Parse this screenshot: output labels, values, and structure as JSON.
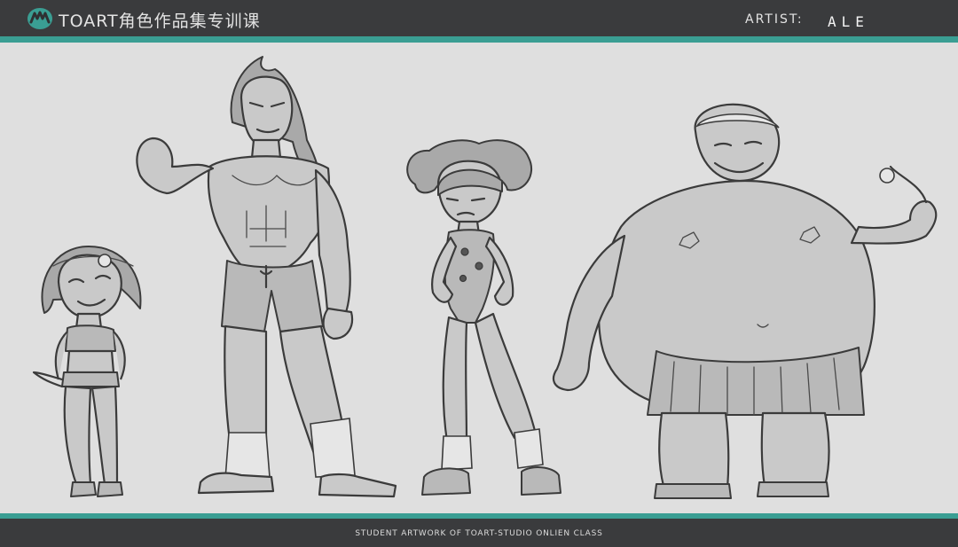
{
  "header": {
    "brand_text": "TOART角色作品集专训课",
    "artist_label": "ARTIST:",
    "artist_name": "ALE"
  },
  "footer": {
    "caption": "STUDENT ARTWORK OF TOART-STUDIO ONLIEN CLASS"
  },
  "colors": {
    "bar": "#3a3b3d",
    "accent": "#3a9e93",
    "canvas": "#dfdfdf",
    "text": "#e3e3e3"
  },
  "icons": {
    "logo": "toart-logo-icon"
  }
}
